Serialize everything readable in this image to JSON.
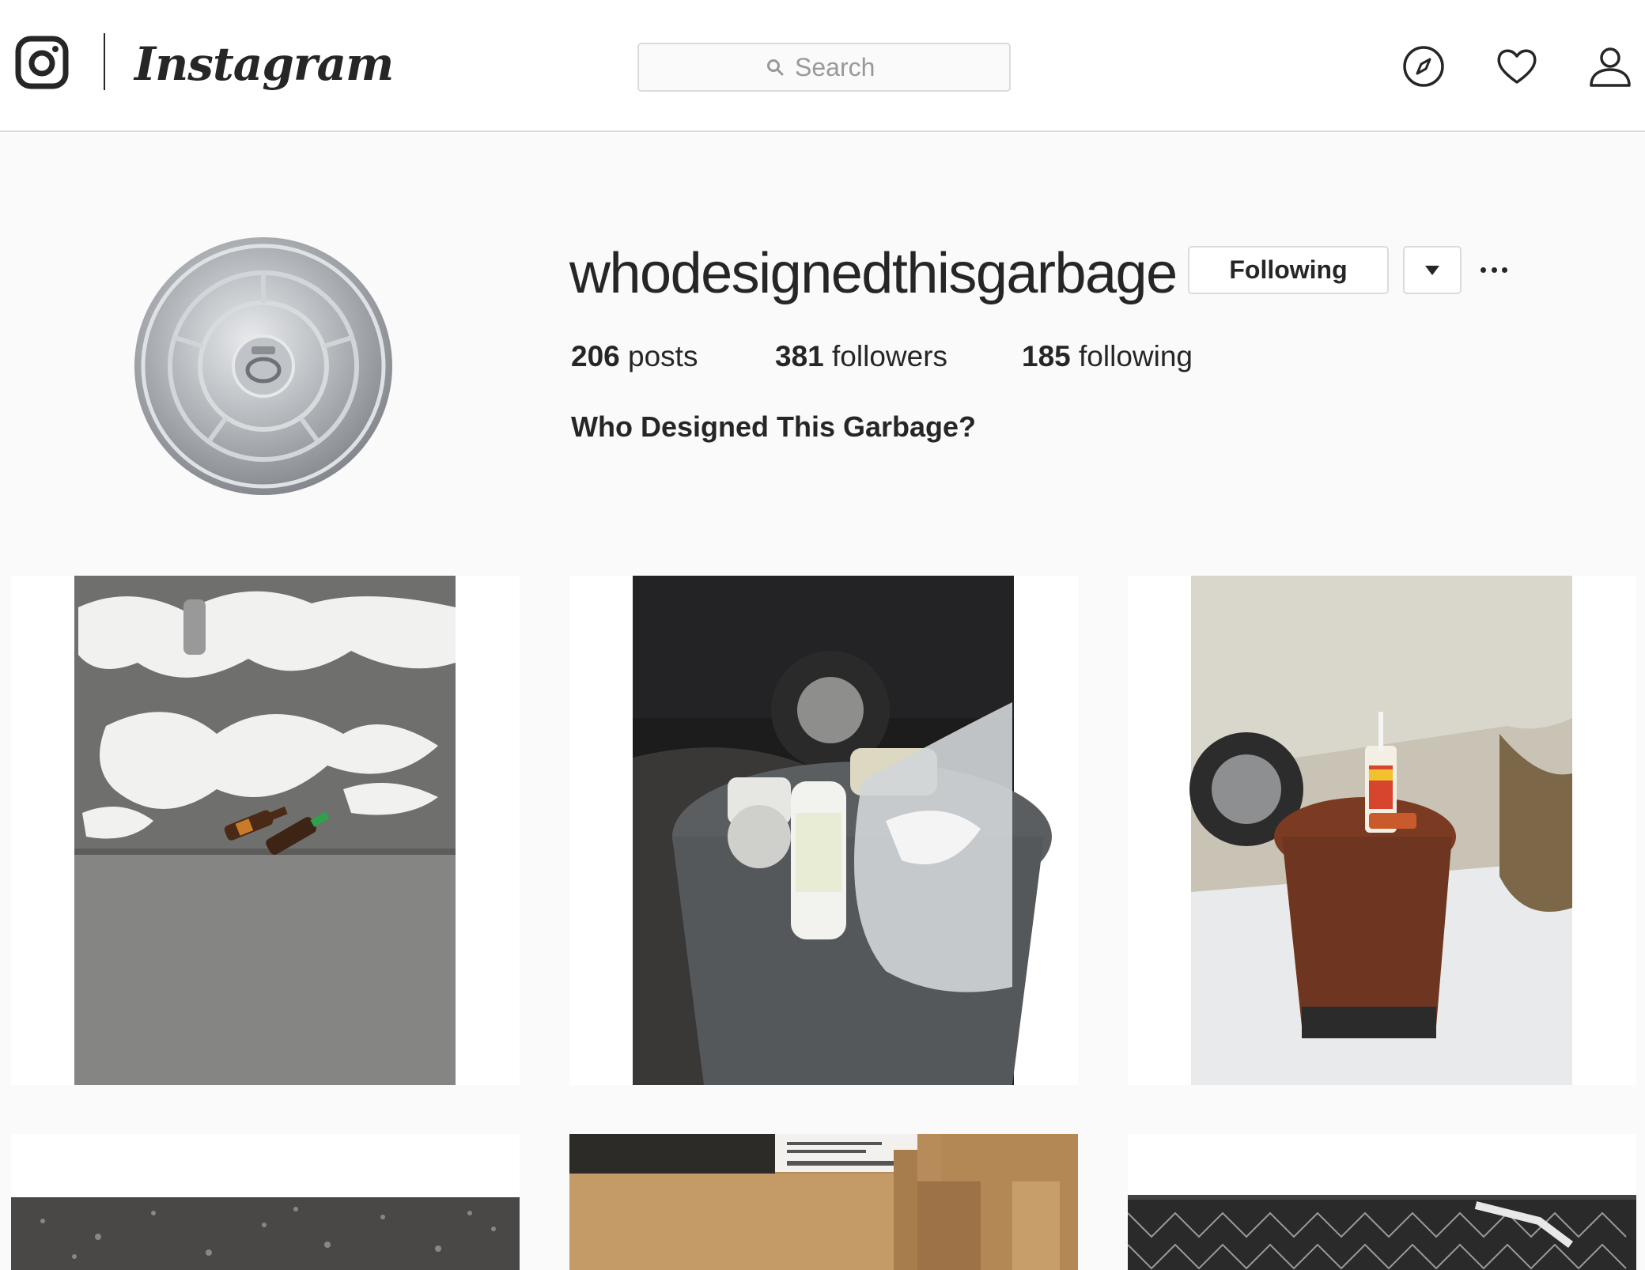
{
  "nav": {
    "brand": "Instagram",
    "search_placeholder": "Search",
    "icons": [
      "instagram-glyph-icon",
      "search-icon",
      "compass-icon",
      "heart-icon",
      "user-icon"
    ]
  },
  "profile": {
    "username": "whodesignedthisgarbage",
    "following_button": "Following",
    "stats": {
      "posts_count": "206",
      "posts_label": "posts",
      "followers_count": "381",
      "followers_label": "followers",
      "following_count": "185",
      "following_label": "following"
    },
    "full_name": "Who Designed This Garbage?"
  },
  "posts": [
    {
      "subject": "beer bottles on snowy sidewalk"
    },
    {
      "subject": "overflowing grey trash can"
    },
    {
      "subject": "brown bin with soda cup in snow"
    },
    {
      "subject": "asphalt"
    },
    {
      "subject": "cardboard boxes"
    },
    {
      "subject": "chain-link fence"
    }
  ],
  "colors": {
    "background": "#fafafa",
    "text": "#262626",
    "border": "#dbdbdb",
    "muted": "#999999"
  }
}
